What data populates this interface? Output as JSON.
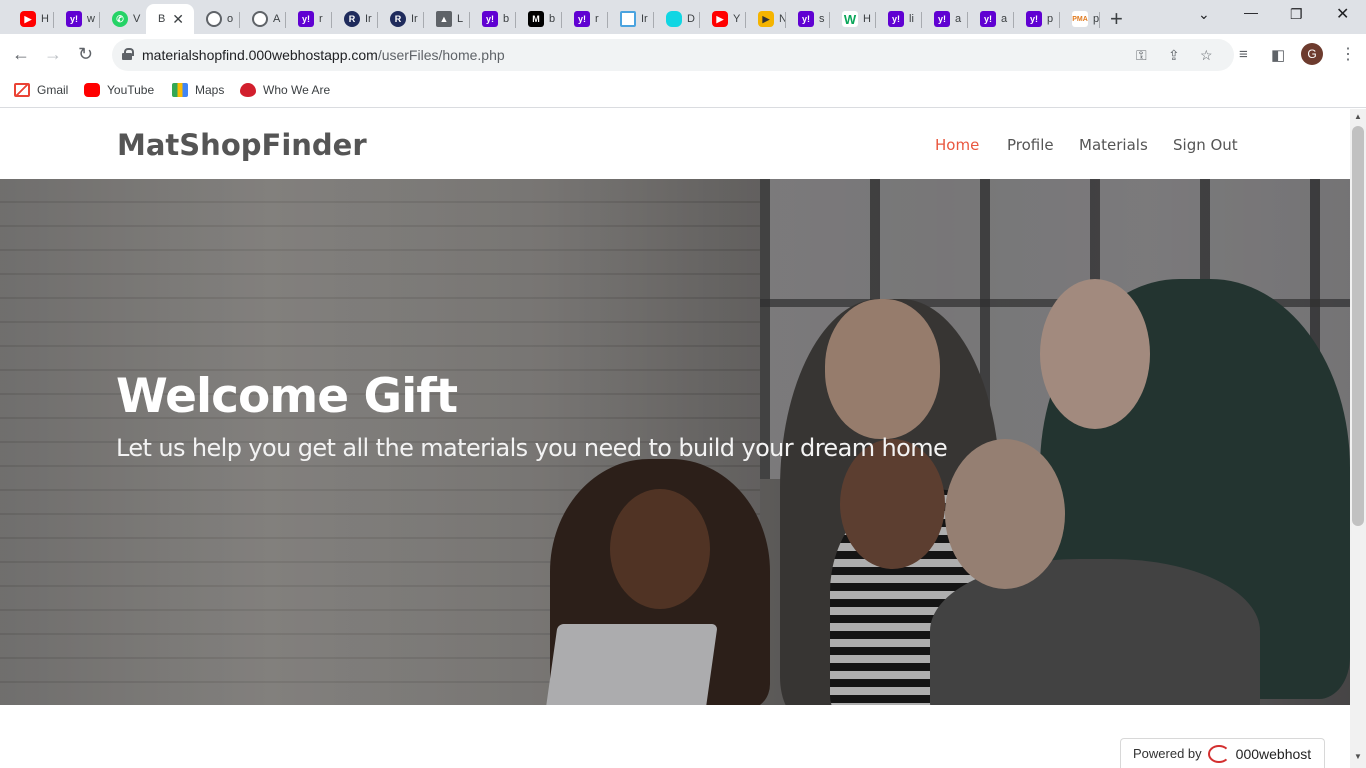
{
  "browser": {
    "tabs": [
      {
        "icon": "youtube-icon",
        "label": "H"
      },
      {
        "icon": "yahoo-icon",
        "label": "w"
      },
      {
        "icon": "whatsapp-icon",
        "label": "V"
      },
      {
        "icon": "none",
        "label": "B"
      },
      {
        "icon": "globe-icon",
        "label": "o"
      },
      {
        "icon": "globe-icon",
        "label": "A"
      },
      {
        "icon": "yahoo-icon",
        "label": "r"
      },
      {
        "icon": "r-icon",
        "label": "Ir"
      },
      {
        "icon": "r-icon",
        "label": "Ir"
      },
      {
        "icon": "graduation-cap-icon",
        "label": "L"
      },
      {
        "icon": "yahoo-icon",
        "label": "b"
      },
      {
        "icon": "medium-icon",
        "label": "b"
      },
      {
        "icon": "yahoo-icon",
        "label": "r"
      },
      {
        "icon": "box-icon",
        "label": "Ir"
      },
      {
        "icon": "cyan-icon",
        "label": "D"
      },
      {
        "icon": "youtube-icon",
        "label": "Y"
      },
      {
        "icon": "play-icon",
        "label": "N"
      },
      {
        "icon": "yahoo-icon",
        "label": "s"
      },
      {
        "icon": "w-icon",
        "label": "H"
      },
      {
        "icon": "yahoo-icon",
        "label": "li"
      },
      {
        "icon": "yahoo-icon",
        "label": "a"
      },
      {
        "icon": "yahoo-icon",
        "label": "a"
      },
      {
        "icon": "yahoo-icon",
        "label": "p"
      },
      {
        "icon": "pma-icon",
        "label": "p"
      }
    ],
    "url_host": "materialshopfind.000webhostapp.com",
    "url_path": "/userFiles/home.php",
    "profile_initial": "G",
    "bookmarks": [
      "Gmail",
      "YouTube",
      "Maps",
      "Who We Are"
    ]
  },
  "site": {
    "brand": "MatShopFinder",
    "nav": [
      "Home",
      "Profile",
      "Materials",
      "Sign Out"
    ],
    "active_nav": "Home",
    "hero_title": "Welcome Gift",
    "hero_subtitle": "Let us help you get all the materials you need to build your dream home",
    "powered_by": "Powered by",
    "powered_brand": "000webhost"
  },
  "colors": {
    "accent": "#e9573f",
    "brand_text": "#555555",
    "tabstrip": "#dee1e6"
  }
}
